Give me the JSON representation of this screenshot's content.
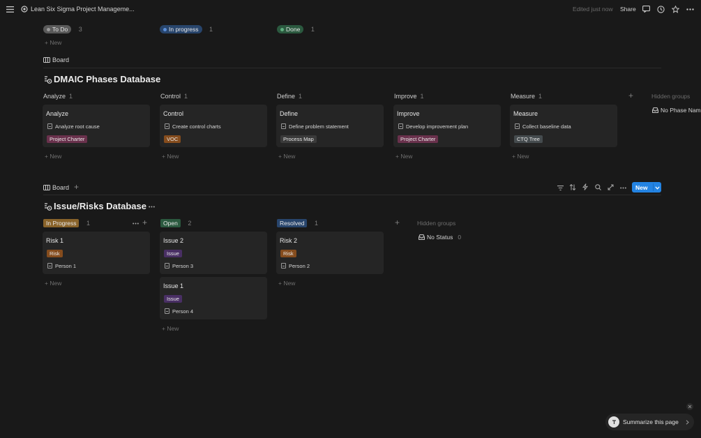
{
  "topbar": {
    "page_title": "Lean Six Sigma Project Manageme...",
    "edited": "Edited just now",
    "share": "Share"
  },
  "status_board": {
    "groups": [
      {
        "label": "To Do",
        "count": "3",
        "color": "#5a5a5a",
        "dot": "#9b9b9b"
      },
      {
        "label": "In progress",
        "count": "1",
        "color": "#28456c",
        "dot": "#5a8ed8"
      },
      {
        "label": "Done",
        "count": "1",
        "color": "#2b593f",
        "dot": "#5fae7f"
      }
    ],
    "new_label": "New"
  },
  "dmaic": {
    "view_label": "Board",
    "title": "DMAIC Phases Database",
    "columns": [
      {
        "name": "Analyze",
        "count": "1",
        "card_title": "Analyze",
        "task": "Analyze root cause",
        "tag": "Project Charter",
        "tag_color": "#69314c"
      },
      {
        "name": "Control",
        "count": "1",
        "card_title": "Control",
        "task": "Create control charts",
        "tag": "VOC",
        "tag_color": "#854c1d"
      },
      {
        "name": "Define",
        "count": "1",
        "card_title": "Define",
        "task": "Define problem statement",
        "tag": "Process Map",
        "tag_color": "#3a3a3a"
      },
      {
        "name": "Improve",
        "count": "1",
        "card_title": "Improve",
        "task": "Develop improvement plan",
        "tag": "Project Charter",
        "tag_color": "#69314c"
      },
      {
        "name": "Measure",
        "count": "1",
        "card_title": "Measure",
        "task": "Collect baseline data",
        "tag": "CTQ Tree",
        "tag_color": "#454b4e"
      }
    ],
    "hidden_groups": "Hidden groups",
    "hidden_item": "No Phase Nam",
    "new_label": "New"
  },
  "issues": {
    "view_label": "Board",
    "new_button": "New",
    "title": "Issue/Risks Database",
    "columns": [
      {
        "name": "In Progress",
        "count": "1",
        "color": "#89632a",
        "cards": [
          {
            "title": "Risk 1",
            "tag": "Risk",
            "tag_color": "#854c1d",
            "person": "Person 1"
          }
        ]
      },
      {
        "name": "Open",
        "count": "2",
        "color": "#2b593f",
        "cards": [
          {
            "title": "Issue 2",
            "tag": "Issue",
            "tag_color": "#492f64",
            "person": "Person 3"
          },
          {
            "title": "Issue 1",
            "tag": "Issue",
            "tag_color": "#492f64",
            "person": "Person 4"
          }
        ]
      },
      {
        "name": "Resolved",
        "count": "1",
        "color": "#28456c",
        "cards": [
          {
            "title": "Risk 2",
            "tag": "Risk",
            "tag_color": "#854c1d",
            "person": "Person 2"
          }
        ]
      }
    ],
    "hidden_groups": "Hidden groups",
    "hidden_item": "No Status",
    "hidden_count": "0",
    "new_label": "New"
  },
  "summarize": "Summarize this page"
}
